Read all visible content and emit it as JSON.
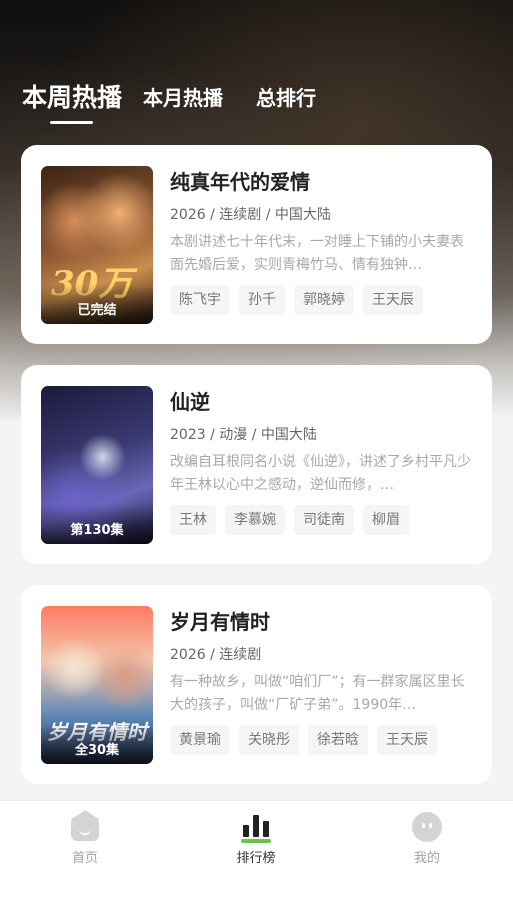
{
  "tabs": [
    {
      "label": "本周热播",
      "active": true
    },
    {
      "label": "本月热播",
      "active": false
    },
    {
      "label": "总排行",
      "active": false
    }
  ],
  "items": [
    {
      "title": "纯真年代的爱情",
      "meta": "2026 / 连续剧 / 中国大陆",
      "desc": "本剧讲述七十年代末，一对睡上下铺的小夫妻表面先婚后爱，实则青梅竹马、情有独钟…",
      "badge": "已完结",
      "poster_text": "30万",
      "cast": [
        "陈飞宇",
        "孙千",
        "郭晓婷",
        "王天辰"
      ]
    },
    {
      "title": "仙逆",
      "meta": "2023 / 动漫 / 中国大陆",
      "desc": "改编自耳根同名小说《仙逆》，讲述了乡村平凡少年王林以心中之感动，逆仙而修，…",
      "badge": "第130集",
      "poster_text": "",
      "cast": [
        "王林",
        "李慕婉",
        "司徒南",
        "柳眉"
      ]
    },
    {
      "title": "岁月有情时",
      "meta": "2026 / 连续剧",
      "desc": "有一种故乡，叫做“咱们厂”；有一群家属区里长大的孩子，叫做“厂矿子弟”。1990年…",
      "badge": "全30集",
      "poster_text": "岁月有情时",
      "cast": [
        "黄景瑜",
        "关晓彤",
        "徐若晗",
        "王天辰"
      ]
    }
  ],
  "nav": [
    {
      "label": "首页",
      "icon": "home-icon",
      "active": false
    },
    {
      "label": "排行榜",
      "icon": "ranking-icon",
      "active": true
    },
    {
      "label": "我的",
      "icon": "profile-icon",
      "active": false
    }
  ]
}
